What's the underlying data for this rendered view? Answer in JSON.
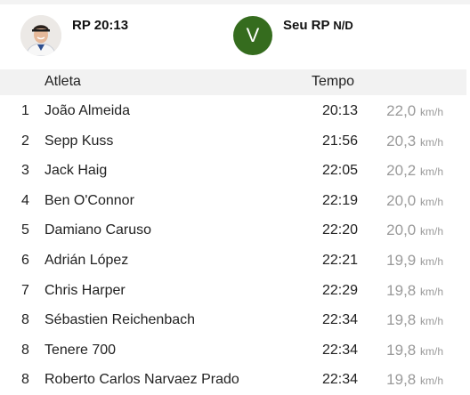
{
  "header": {
    "pr_label": "RP",
    "pr_value": "20:13",
    "your_avatar_letter": "V",
    "your_pr_label": "Seu RP",
    "your_pr_value": "N/D",
    "accent_color": "#356c1e"
  },
  "table": {
    "columns": [
      "Atleta",
      "Tempo"
    ],
    "rows": [
      {
        "rank": "1",
        "name": "João Almeida",
        "time": "20:13",
        "speed": "22,0",
        "unit": "km/h"
      },
      {
        "rank": "2",
        "name": "Sepp Kuss",
        "time": "21:56",
        "speed": "20,3",
        "unit": "km/h"
      },
      {
        "rank": "3",
        "name": "Jack Haig",
        "time": "22:05",
        "speed": "20,2",
        "unit": "km/h"
      },
      {
        "rank": "4",
        "name": "Ben O'Connor",
        "time": "22:19",
        "speed": "20,0",
        "unit": "km/h"
      },
      {
        "rank": "5",
        "name": "Damiano Caruso",
        "time": "22:20",
        "speed": "20,0",
        "unit": "km/h"
      },
      {
        "rank": "6",
        "name": "Adrián López",
        "time": "22:21",
        "speed": "19,9",
        "unit": "km/h"
      },
      {
        "rank": "7",
        "name": "Chris Harper",
        "time": "22:29",
        "speed": "19,8",
        "unit": "km/h"
      },
      {
        "rank": "8",
        "name": "Sébastien Reichenbach",
        "time": "22:34",
        "speed": "19,8",
        "unit": "km/h"
      },
      {
        "rank": "8",
        "name": "Tenere 700",
        "time": "22:34",
        "speed": "19,8",
        "unit": "km/h"
      },
      {
        "rank": "8",
        "name": "Roberto Carlos Narvaez Prado",
        "time": "22:34",
        "speed": "19,8",
        "unit": "km/h"
      }
    ]
  }
}
